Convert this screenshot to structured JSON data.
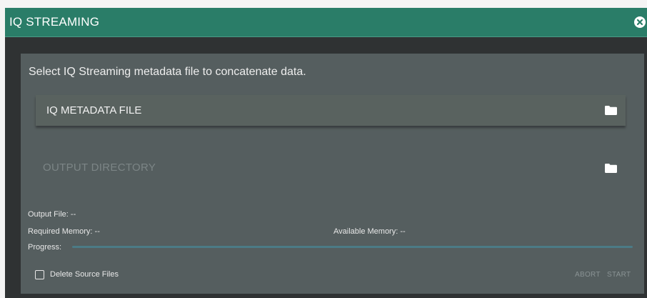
{
  "dialog": {
    "title": "IQ STREAMING",
    "close_icon": "close-circle-icon",
    "colors": {
      "titlebar": "#2a7d68",
      "panel": "#555e5f",
      "background": "#2f3233"
    }
  },
  "panel": {
    "instruction": "Select IQ Streaming metadata file to concatenate data.",
    "metadata_file": {
      "label": "IQ METADATA FILE",
      "icon": "folder-icon"
    },
    "output_directory": {
      "label": "OUTPUT DIRECTORY",
      "icon": "folder-icon"
    },
    "output_file": "Output File: --",
    "required_memory": "Required Memory: --",
    "available_memory": "Available Memory: --",
    "progress_label": "Progress:",
    "progress_fraction": 0,
    "delete_source_files": {
      "label": "Delete Source Files",
      "checked": false
    },
    "abort_label": "ABORT",
    "start_label": "START"
  }
}
